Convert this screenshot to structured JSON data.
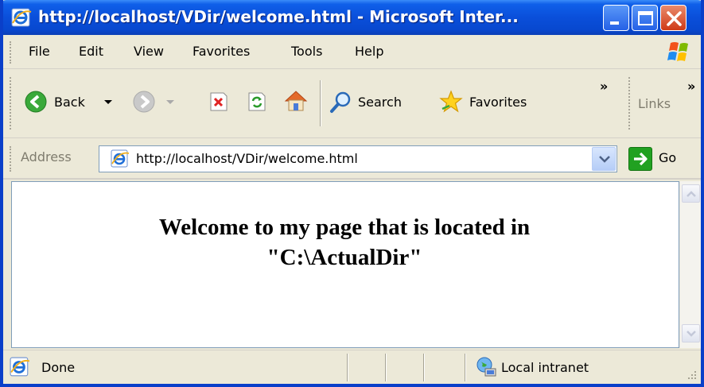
{
  "window": {
    "title": "http://localhost/VDir/welcome.html - Microsoft Inter...",
    "controls": [
      "minimize-icon",
      "maximize-icon",
      "close-icon"
    ]
  },
  "menu": {
    "items": [
      "File",
      "Edit",
      "View",
      "Favorites",
      "Tools",
      "Help"
    ]
  },
  "toolbar": {
    "back_label": "Back",
    "search_label": "Search",
    "favorites_label": "Favorites",
    "overflow_glyph": "»",
    "links_label": "Links"
  },
  "address": {
    "label": "Address",
    "url": "http://localhost/VDir/welcome.html",
    "go_label": "Go"
  },
  "page": {
    "heading_line1": "Welcome to my page that is located in",
    "heading_line2": "\"C:\\ActualDir\""
  },
  "status": {
    "text": "Done",
    "zone": "Local intranet"
  },
  "colors": {
    "titlebar": "#0a4fda",
    "chrome": "#ece9d8",
    "go_button": "#21a121",
    "close_button": "#cf3a17"
  }
}
